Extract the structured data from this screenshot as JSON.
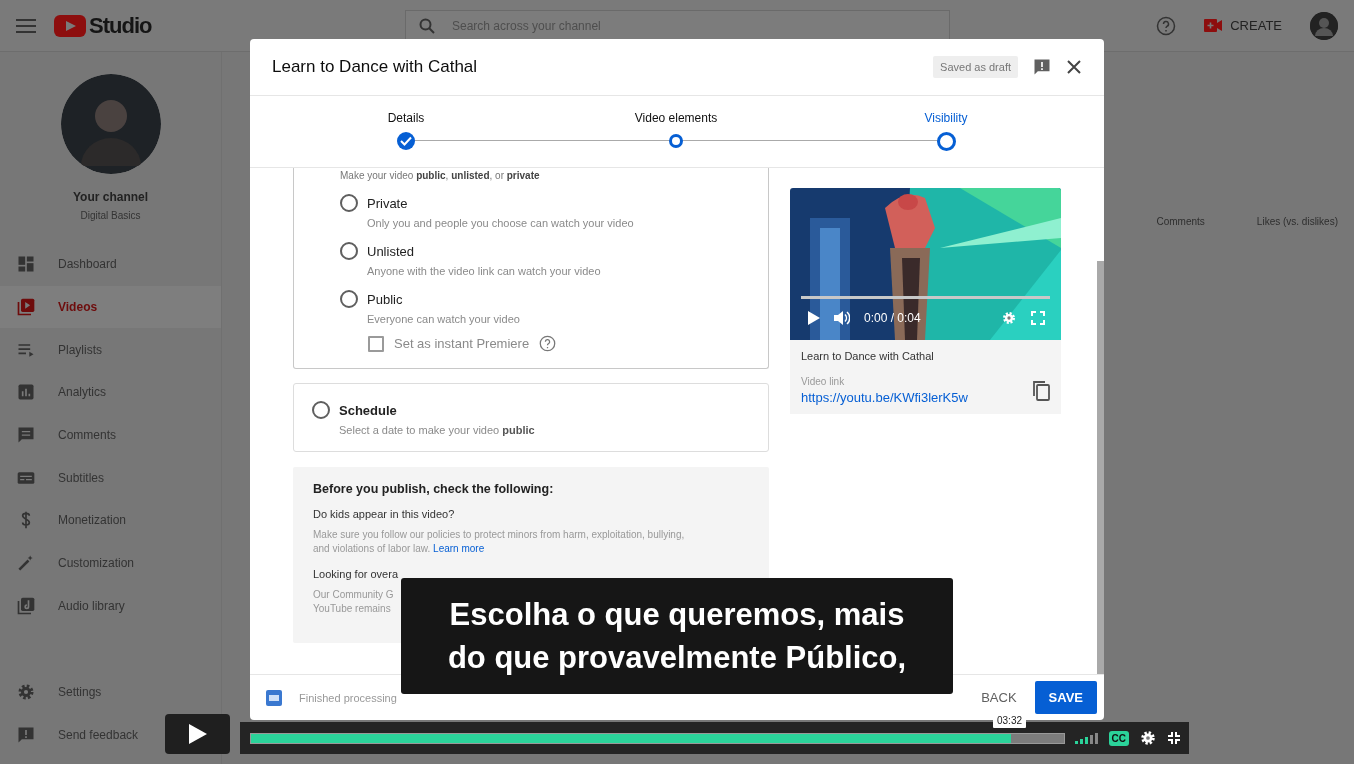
{
  "header": {
    "logo_text": "Studio",
    "search_placeholder": "Search across your channel",
    "create_label": "CREATE"
  },
  "channel": {
    "title": "Your channel",
    "subtitle": "Digital Basics"
  },
  "nav": [
    {
      "label": "Dashboard",
      "kind": "dashboard",
      "selected": false
    },
    {
      "label": "Videos",
      "kind": "videos",
      "selected": true
    },
    {
      "label": "Playlists",
      "kind": "playlists",
      "selected": false
    },
    {
      "label": "Analytics",
      "kind": "analytics",
      "selected": false
    },
    {
      "label": "Comments",
      "kind": "comments",
      "selected": false
    },
    {
      "label": "Subtitles",
      "kind": "subtitles",
      "selected": false
    },
    {
      "label": "Monetization",
      "kind": "monetization",
      "selected": false
    },
    {
      "label": "Customization",
      "kind": "customization",
      "selected": false
    },
    {
      "label": "Audio library",
      "kind": "audio",
      "selected": false
    }
  ],
  "nav_bottom": [
    {
      "label": "Settings",
      "kind": "settings"
    },
    {
      "label": "Send feedback",
      "kind": "feedback"
    }
  ],
  "background_columns": [
    "Comments",
    "Likes (vs. dislikes)"
  ],
  "dialog": {
    "title": "Learn to Dance with Cathal",
    "draft_badge": "Saved as draft",
    "steps": [
      {
        "label": "Details",
        "kind": "done"
      },
      {
        "label": "Video elements",
        "kind": "visited"
      },
      {
        "label": "Visibility",
        "kind": "current"
      }
    ],
    "save_intro": "Make your video **public**, **unlisted**, or **private**",
    "options": [
      {
        "label": "Private",
        "description": "Only you and people you choose can watch your video",
        "selected": false
      },
      {
        "label": "Unlisted",
        "description": "Anyone with the video link can watch your video",
        "selected": false
      },
      {
        "label": "Public",
        "description": "Everyone can watch your video",
        "selected": false
      }
    ],
    "premiere": {
      "label": "Set as instant Premiere",
      "checked": false
    },
    "schedule": {
      "label": "Schedule",
      "description": "Select a date to make your video **public**",
      "selected": false
    },
    "checklist": {
      "title": "Before you publish, check the following:",
      "question_1": "Do kids appear in this video?",
      "text_1": "Make sure you follow our policies to protect minors from harm, exploitation, bullying, and violations of labor law.",
      "link_1": "Learn more",
      "question_2": "Looking for overa",
      "text_2_lines": [
        "Our Community G",
        "YouTube remains"
      ]
    },
    "preview": {
      "time": "0:00 / 0:04",
      "title": "Learn to Dance with Cathal",
      "link_label": "Video link",
      "link": "https://youtu.be/KWfi3lerK5w"
    },
    "footer": {
      "status": "Finished processing",
      "back": "BACK",
      "save": "SAVE"
    }
  },
  "subtitle": [
    "Escolha o que queremos, mais",
    "do que provavelmente Público,"
  ],
  "player": {
    "tooltip": "03:32",
    "level": 0.935,
    "cc": "CC"
  }
}
